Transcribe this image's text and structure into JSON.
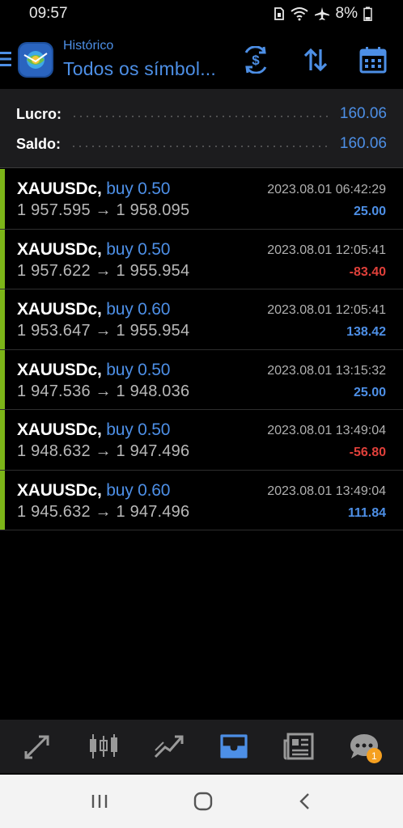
{
  "status_bar": {
    "time": "09:57",
    "battery": "8%"
  },
  "header": {
    "subtitle": "Histórico",
    "title": "Todos os símbol..."
  },
  "summary": {
    "profit_label": "Lucro:",
    "profit_value": "160.06",
    "balance_label": "Saldo:",
    "balance_value": "160.06"
  },
  "trades": [
    {
      "symbol": "XAUUSDc,",
      "side": "buy 0.50",
      "prices": "1 957.595 → 1 958.095",
      "time": "2023.08.01 06:42:29",
      "profit": "25.00"
    },
    {
      "symbol": "XAUUSDc,",
      "side": "buy 0.50",
      "prices": "1 957.622 → 1 955.954",
      "time": "2023.08.01 12:05:41",
      "profit": "-83.40"
    },
    {
      "symbol": "XAUUSDc,",
      "side": "buy 0.60",
      "prices": "1 953.647 → 1 955.954",
      "time": "2023.08.01 12:05:41",
      "profit": "138.42"
    },
    {
      "symbol": "XAUUSDc,",
      "side": "buy 0.50",
      "prices": "1 947.536 → 1 948.036",
      "time": "2023.08.01 13:15:32",
      "profit": "25.00"
    },
    {
      "symbol": "XAUUSDc,",
      "side": "buy 0.50",
      "prices": "1 948.632 → 1 947.496",
      "time": "2023.08.01 13:49:04",
      "profit": "-56.80"
    },
    {
      "symbol": "XAUUSDc,",
      "side": "buy 0.60",
      "prices": "1 945.632 → 1 947.496",
      "time": "2023.08.01 13:49:04",
      "profit": "111.84"
    }
  ],
  "tabs": {
    "items": [
      "quotes-icon",
      "chart-icon",
      "trade-icon",
      "history-icon",
      "news-icon",
      "chat-icon"
    ],
    "active": "history-icon",
    "chat_badge": "1"
  },
  "colors": {
    "accent": "#4d8fe6",
    "loss": "#e0403a",
    "buy_bar": "#7cb518"
  }
}
